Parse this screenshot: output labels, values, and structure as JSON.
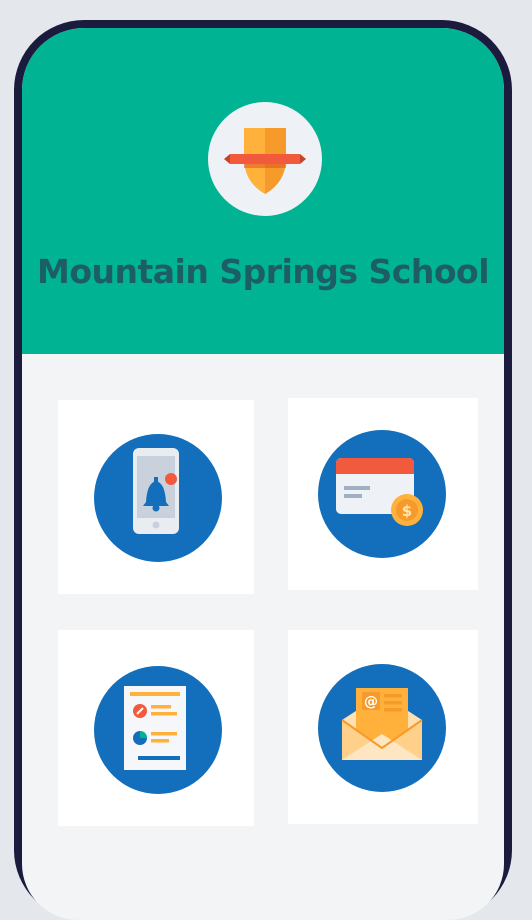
{
  "school": {
    "name": "Mountain Springs School",
    "logo_icon": "shield-ribbon-icon"
  },
  "tiles": [
    {
      "id": "notifications",
      "icon": "phone-bell-icon"
    },
    {
      "id": "payments",
      "icon": "card-dollar-icon"
    },
    {
      "id": "reports",
      "icon": "document-chart-icon"
    },
    {
      "id": "messages",
      "icon": "envelope-at-icon"
    }
  ],
  "colors": {
    "header": "#00b393",
    "title": "#1d5d66",
    "icon_circle": "#136fbb",
    "phone_frame": "#1a1b3d",
    "background": "#f3f4f6"
  }
}
